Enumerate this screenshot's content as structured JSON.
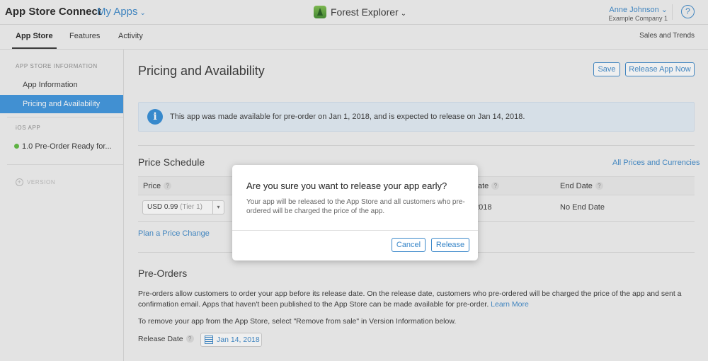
{
  "header": {
    "brand": "App Store Connect",
    "my_apps": "My Apps",
    "app_name": "Forest Explorer",
    "user_name": "Anne Johnson",
    "company": "Example Company 1",
    "help": "?",
    "chevron": "⌄",
    "icons": [
      "forest-explorer-app-icon",
      "help-icon",
      "chevron-down-icon"
    ]
  },
  "subnav": {
    "tabs": [
      "App Store",
      "Features",
      "Activity"
    ],
    "active_tab": "App Store",
    "right_link": "Sales and Trends"
  },
  "sidebar": {
    "section1": "APP STORE INFORMATION",
    "items": [
      "App Information",
      "Pricing and Availability"
    ],
    "active_item": "Pricing and Availability",
    "section2": "iOS APP",
    "ios_item": "1.0 Pre-Order Ready for...",
    "version_label": "VERSION",
    "status_color": "#5aba3c"
  },
  "main": {
    "title": "Pricing and Availability",
    "save_label": "Save",
    "release_now_label": "Release App Now",
    "info_text": "This app was made available for pre-order on Jan 1, 2018, and is expected to release on Jan 14, 2018.",
    "price_schedule": {
      "title": "Price Schedule",
      "all_prices_link": "All Prices and Currencies",
      "columns": [
        "Price",
        "ate",
        "End Date"
      ],
      "price_value": "USD 0.99",
      "price_tier": "(Tier 1)",
      "start_date_partial": "2018",
      "end_date": "No End Date",
      "plan_link": "Plan a Price Change"
    },
    "pre_orders": {
      "title": "Pre-Orders",
      "description": "Pre-orders allow customers to order your app before its release date. On the release date, customers who pre-ordered will be charged the price of the app and sent a confirmation email. Apps that haven't been published to the App Store can be made available for pre-order.",
      "learn_more": "Learn More",
      "remove_text": "To remove your app from the App Store, select \"Remove from sale\" in Version Information below.",
      "release_date_label": "Release Date",
      "release_date_value": "Jan 14, 2018"
    }
  },
  "dialog": {
    "title": "Are you sure you want to release your app early?",
    "body": "Your app will be released to the App Store and all customers who pre-ordered will be charged the price of the app.",
    "cancel_label": "Cancel",
    "release_label": "Release"
  },
  "colors": {
    "accent": "#3a87c9",
    "sidebar_active": "#3a93de",
    "info_bg": "#e3edf6"
  }
}
